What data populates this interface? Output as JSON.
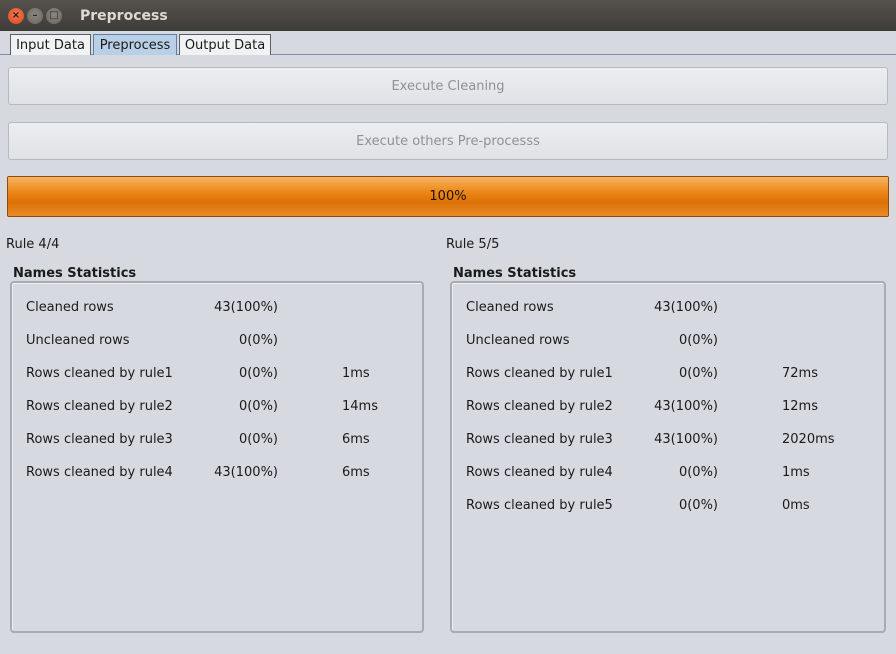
{
  "window": {
    "title": "Preprocess",
    "close_glyph": "×",
    "min_glyph": "–",
    "max_glyph": "□"
  },
  "tabs": [
    {
      "label": "Input Data"
    },
    {
      "label": "Preprocess",
      "active": true
    },
    {
      "label": "Output Data"
    }
  ],
  "buttons": {
    "execute_cleaning": "Execute Cleaning",
    "execute_others": "Execute others Pre-processs"
  },
  "progress": {
    "value": 100,
    "text": "100%"
  },
  "left_panel": {
    "rule_label": "Rule 4/4",
    "title": "Names Statistics",
    "rows": [
      {
        "label": "Cleaned rows",
        "value": "43(100%)",
        "time": ""
      },
      {
        "label": "Uncleaned rows",
        "value": "0(0%)",
        "time": ""
      },
      {
        "label": "Rows cleaned by rule1",
        "value": "0(0%)",
        "time": "1ms"
      },
      {
        "label": "Rows cleaned by rule2",
        "value": "0(0%)",
        "time": "14ms"
      },
      {
        "label": "Rows cleaned by rule3",
        "value": "0(0%)",
        "time": "6ms"
      },
      {
        "label": "Rows cleaned by rule4",
        "value": "43(100%)",
        "time": "6ms"
      }
    ]
  },
  "right_panel": {
    "rule_label": "Rule 5/5",
    "title": "Names Statistics",
    "rows": [
      {
        "label": "Cleaned rows",
        "value": "43(100%)",
        "time": ""
      },
      {
        "label": "Uncleaned rows",
        "value": "0(0%)",
        "time": ""
      },
      {
        "label": "Rows cleaned by rule1",
        "value": "0(0%)",
        "time": "72ms"
      },
      {
        "label": "Rows cleaned by rule2",
        "value": "43(100%)",
        "time": "12ms"
      },
      {
        "label": "Rows cleaned by rule3",
        "value": "43(100%)",
        "time": "2020ms"
      },
      {
        "label": "Rows cleaned by rule4",
        "value": "0(0%)",
        "time": "1ms"
      },
      {
        "label": "Rows cleaned by rule5",
        "value": "0(0%)",
        "time": "0ms"
      }
    ]
  }
}
